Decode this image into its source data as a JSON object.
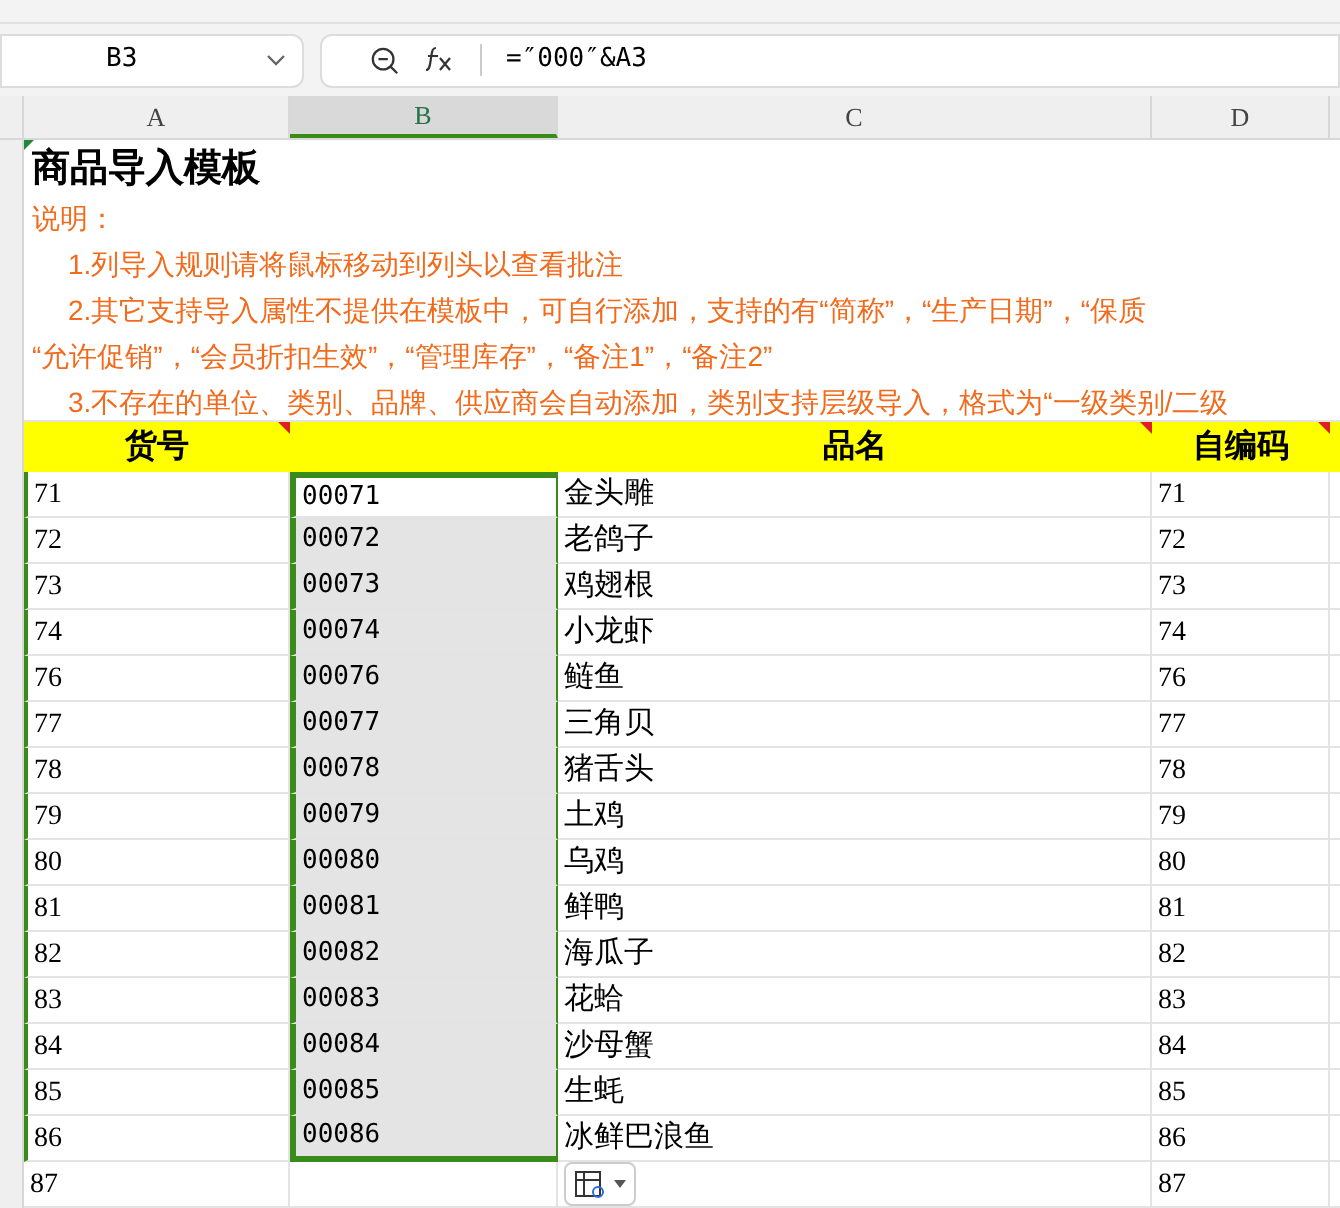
{
  "name_box": "B3",
  "formula": "=″000″&A3",
  "columns": [
    {
      "label": "A",
      "selected": false
    },
    {
      "label": "B",
      "selected": true
    },
    {
      "label": "C",
      "selected": false
    },
    {
      "label": "D",
      "selected": false
    }
  ],
  "title": "商品导入模板",
  "notes": [
    "说明：",
    "1.列导入规则请将鼠标移动到列头以查看批注",
    "2.其它支持导入属性不提供在模板中，可自行添加，支持的有“简称”，“生产日期”，“保质",
    "“允许促销”，“会员折扣生效”，“管理库存”，“备注1”，“备注2”",
    "3.不存在的单位、类别、品牌、供应商会自动添加，类别支持层级导入，格式为“一级类别/二级"
  ],
  "header": {
    "a": {
      "text": "货号",
      "comment": true
    },
    "c": {
      "text": "品名",
      "comment": true
    },
    "d": {
      "text": "自编码",
      "comment": true
    }
  },
  "rows": [
    {
      "a": "71",
      "b": "00071",
      "c": "金头雕",
      "d": "71",
      "selected": true,
      "active": true
    },
    {
      "a": "72",
      "b": "00072",
      "c": "老鸽子",
      "d": "72",
      "selected": true,
      "active": false
    },
    {
      "a": "73",
      "b": "00073",
      "c": "鸡翅根",
      "d": "73",
      "selected": true,
      "active": false
    },
    {
      "a": "74",
      "b": "00074",
      "c": "小龙虾",
      "d": "74",
      "selected": true,
      "active": false
    },
    {
      "a": "76",
      "b": "00076",
      "c": "鲢鱼",
      "d": "76",
      "selected": true,
      "active": false
    },
    {
      "a": "77",
      "b": "00077",
      "c": "三角贝",
      "d": "77",
      "selected": true,
      "active": false
    },
    {
      "a": "78",
      "b": "00078",
      "c": "猪舌头",
      "d": "78",
      "selected": true,
      "active": false
    },
    {
      "a": "79",
      "b": "00079",
      "c": "土鸡",
      "d": "79",
      "selected": true,
      "active": false
    },
    {
      "a": "80",
      "b": "00080",
      "c": "乌鸡",
      "d": "80",
      "selected": true,
      "active": false
    },
    {
      "a": "81",
      "b": "00081",
      "c": "鲜鸭",
      "d": "81",
      "selected": true,
      "active": false
    },
    {
      "a": "82",
      "b": "00082",
      "c": "海瓜子",
      "d": "82",
      "selected": true,
      "active": false
    },
    {
      "a": "83",
      "b": "00083",
      "c": "花蛤",
      "d": "83",
      "selected": true,
      "active": false
    },
    {
      "a": "84",
      "b": "00084",
      "c": "沙母蟹",
      "d": "84",
      "selected": true,
      "active": false
    },
    {
      "a": "85",
      "b": "00085",
      "c": "生蚝",
      "d": "85",
      "selected": true,
      "active": false
    },
    {
      "a": "86",
      "b": "00086",
      "c": "冰鲜巴浪鱼",
      "d": "86",
      "selected": true,
      "active": false
    },
    {
      "a": "87",
      "d": "87",
      "selected": false,
      "active": false,
      "paste_options": true
    }
  ]
}
